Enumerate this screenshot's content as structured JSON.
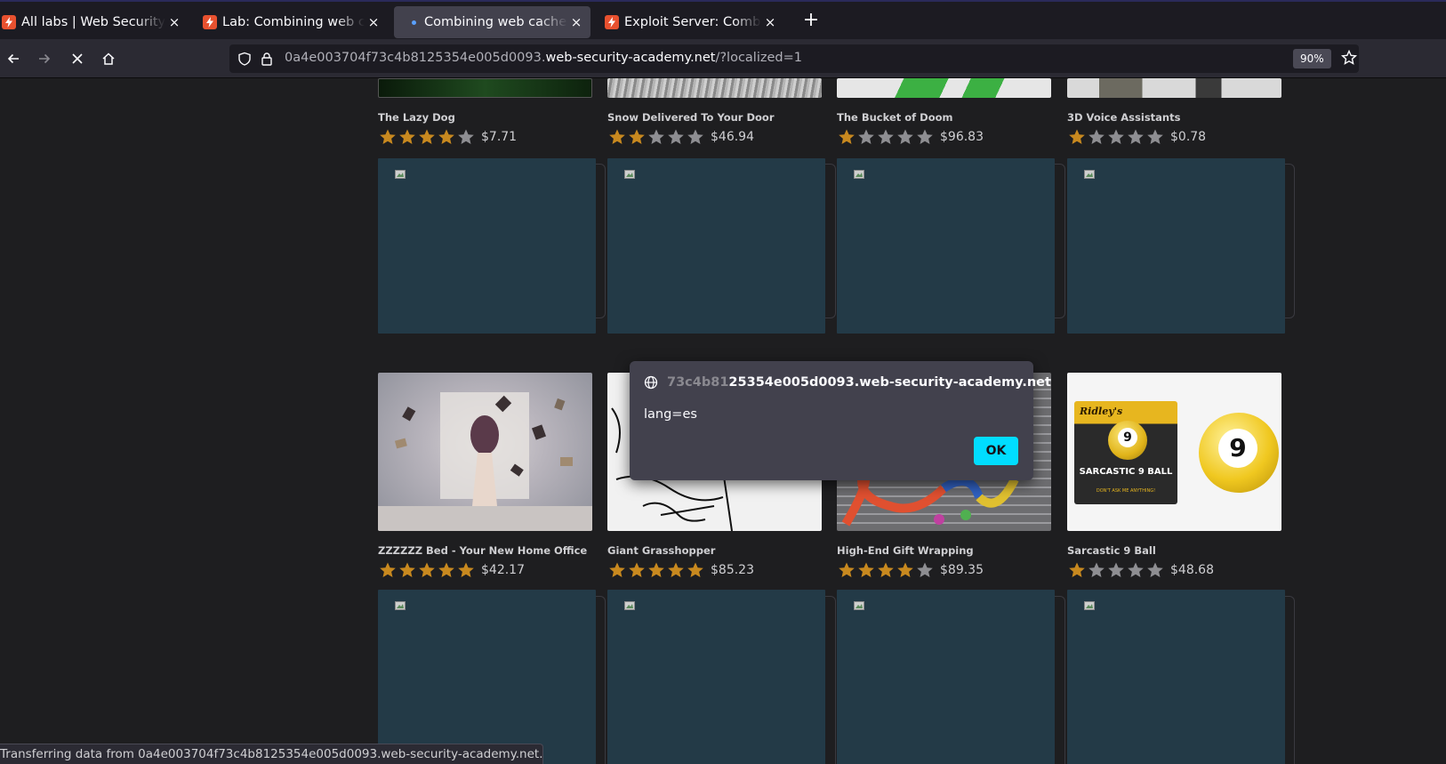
{
  "tabs": [
    {
      "title": "All labs | Web Security Academy",
      "active": false,
      "close": "×"
    },
    {
      "title": "Lab: Combining web cache poisoning",
      "active": false,
      "close": "×"
    },
    {
      "title": "Combining web cache poisoning",
      "active": true,
      "close": "×"
    },
    {
      "title": "Exploit Server: Combining web cache",
      "active": false,
      "close": "×"
    }
  ],
  "new_tab_label": "+",
  "url": {
    "prefix": "0a4e003704f73c4b8125354e005d0093.",
    "domain": "web-security-academy.net",
    "path": "/?localized=1"
  },
  "zoom": "90%",
  "products_row1": [
    {
      "name": "The Lazy Dog",
      "rating": 4,
      "price": "$7.71"
    },
    {
      "name": "Snow Delivered To Your Door",
      "rating": 2,
      "price": "$46.94"
    },
    {
      "name": "The Bucket of Doom",
      "rating": 1,
      "price": "$96.83"
    },
    {
      "name": "3D Voice Assistants",
      "rating": 1,
      "price": "$0.78"
    }
  ],
  "products_row2": [
    {
      "name": "ZZZZZZ Bed - Your New Home Office",
      "rating": 5,
      "price": "$42.17"
    },
    {
      "name": "Giant Grasshopper",
      "rating": 5,
      "price": "$85.23"
    },
    {
      "name": "High-End Gift Wrapping",
      "rating": 4,
      "price": "$89.35"
    },
    {
      "name": "Sarcastic 9 Ball",
      "rating": 1,
      "price": "$48.68"
    }
  ],
  "product_image_text": {
    "brand": "Ridley's",
    "ball_number": "9",
    "box_title": "SARCASTIC 9 BALL",
    "box_tagline": "DON'T ASK ME ANYTHING!"
  },
  "dialog": {
    "origin_faded": "73c4b81",
    "origin": "25354e005d0093.web-security-academy.net",
    "message": "lang=es",
    "ok_label": "OK"
  },
  "status_text": "Transferring data from 0a4e003704f73c4b8125354e005d0093.web-security-academy.net...",
  "colors": {
    "star_filled": "#c8891f",
    "star_empty": "#8e8e92",
    "ok_button": "#00ddff",
    "ad_block": "#233a47"
  }
}
